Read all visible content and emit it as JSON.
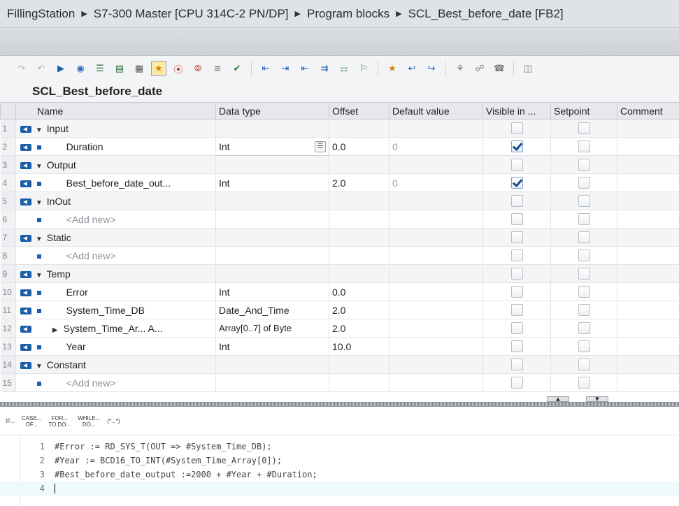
{
  "breadcrumb": [
    "FillingStation",
    "S7-300 Master [CPU 314C-2 PN/DP]",
    "Program blocks",
    "SCL_Best_before_date [FB2]"
  ],
  "block_title": "SCL_Best_before_date",
  "columns": [
    "Name",
    "Data type",
    "Offset",
    "Default value",
    "Visible in ...",
    "Setpoint",
    "Comment"
  ],
  "rows": [
    {
      "num": "1",
      "name": "Input",
      "type": "",
      "offset": "",
      "default": ""
    },
    {
      "num": "2",
      "name": "Duration",
      "type": "Int",
      "offset": "0.0",
      "default": "0"
    },
    {
      "num": "3",
      "name": "Output",
      "type": "",
      "offset": "",
      "default": ""
    },
    {
      "num": "4",
      "name": "Best_before_date_out...",
      "type": "Int",
      "offset": "2.0",
      "default": "0"
    },
    {
      "num": "5",
      "name": "InOut",
      "type": "",
      "offset": "",
      "default": ""
    },
    {
      "num": "6",
      "name": "<Add new>",
      "type": "",
      "offset": "",
      "default": ""
    },
    {
      "num": "7",
      "name": "Static",
      "type": "",
      "offset": "",
      "default": ""
    },
    {
      "num": "8",
      "name": "<Add new>",
      "type": "",
      "offset": "",
      "default": ""
    },
    {
      "num": "9",
      "name": "Temp",
      "type": "",
      "offset": "",
      "default": ""
    },
    {
      "num": "10",
      "name": "Error",
      "type": "Int",
      "offset": "0.0",
      "default": ""
    },
    {
      "num": "11",
      "name": "System_Time_DB",
      "type": "Date_And_Time",
      "offset": "2.0",
      "default": ""
    },
    {
      "num": "12",
      "name": "System_Time_Ar... A...",
      "type": "Array[0..7] of Byte",
      "offset": "2.0",
      "default": ""
    },
    {
      "num": "13",
      "name": "Year",
      "type": "Int",
      "offset": "10.0",
      "default": ""
    },
    {
      "num": "14",
      "name": "Constant",
      "type": "",
      "offset": "",
      "default": ""
    },
    {
      "num": "15",
      "name": "<Add new>",
      "type": "",
      "offset": "",
      "default": ""
    }
  ],
  "snippets": [
    {
      "l1": "IF...",
      "l2": ""
    },
    {
      "l1": "CASE...",
      "l2": "OF..."
    },
    {
      "l1": "FOR...",
      "l2": "TO DO..."
    },
    {
      "l1": "WHILE...",
      "l2": "DO..."
    },
    {
      "l1": "(*...*)",
      "l2": ""
    }
  ],
  "code_lines": [
    {
      "num": "1",
      "text": "#Error := RD_SYS_T(OUT => #System_Time_DB);"
    },
    {
      "num": "2",
      "text": "#Year := BCD16_TO_INT(#System_Time_Array[0]);"
    },
    {
      "num": "3",
      "text": "#Best_before_date_output :=2000 + #Year + #Duration;"
    },
    {
      "num": "4",
      "text": ""
    }
  ],
  "colors": {
    "accent": "#1b5fb3",
    "io_icon": "#1a5ea8",
    "current_line": "#eef9fb"
  }
}
